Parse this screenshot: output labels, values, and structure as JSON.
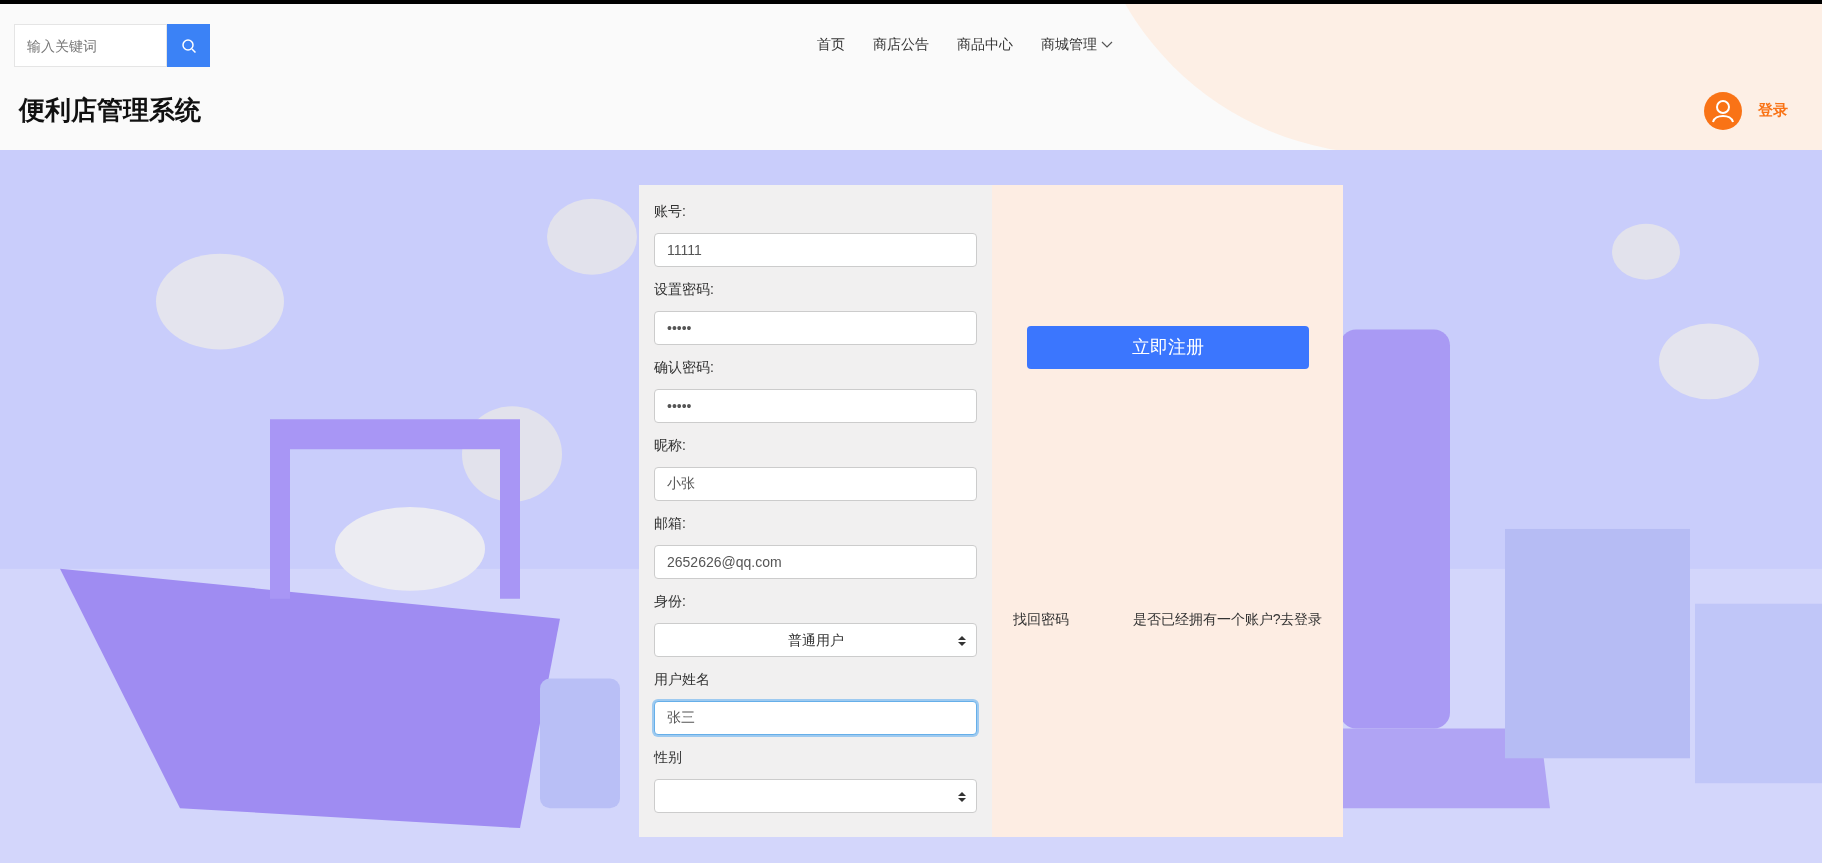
{
  "search": {
    "placeholder": "输入关键词"
  },
  "nav": [
    {
      "label": "首页",
      "dropdown": false
    },
    {
      "label": "商店公告",
      "dropdown": false
    },
    {
      "label": "商品中心",
      "dropdown": false
    },
    {
      "label": "商城管理",
      "dropdown": true
    }
  ],
  "site_title": "便利店管理系统",
  "login_link": "登录",
  "form": {
    "fields": [
      {
        "label": "账号:",
        "kind": "text",
        "value": "11111",
        "focused": false
      },
      {
        "label": "设置密码:",
        "kind": "text",
        "value": "•••••",
        "focused": false
      },
      {
        "label": "确认密码:",
        "kind": "text",
        "value": "•••••",
        "focused": false
      },
      {
        "label": "昵称:",
        "kind": "text",
        "value": "小张",
        "focused": false
      },
      {
        "label": "邮箱:",
        "kind": "text",
        "value": "2652626@qq.com",
        "focused": false
      },
      {
        "label": "身份:",
        "kind": "select",
        "value": "普通用户",
        "focused": false
      },
      {
        "label": "用户姓名",
        "kind": "text",
        "value": "张三",
        "focused": true
      },
      {
        "label": "性别",
        "kind": "select",
        "focused": false
      }
    ],
    "submit": "立即注册",
    "links": [
      "找回密码",
      "是否已经拥有一个账户?去登录"
    ]
  }
}
